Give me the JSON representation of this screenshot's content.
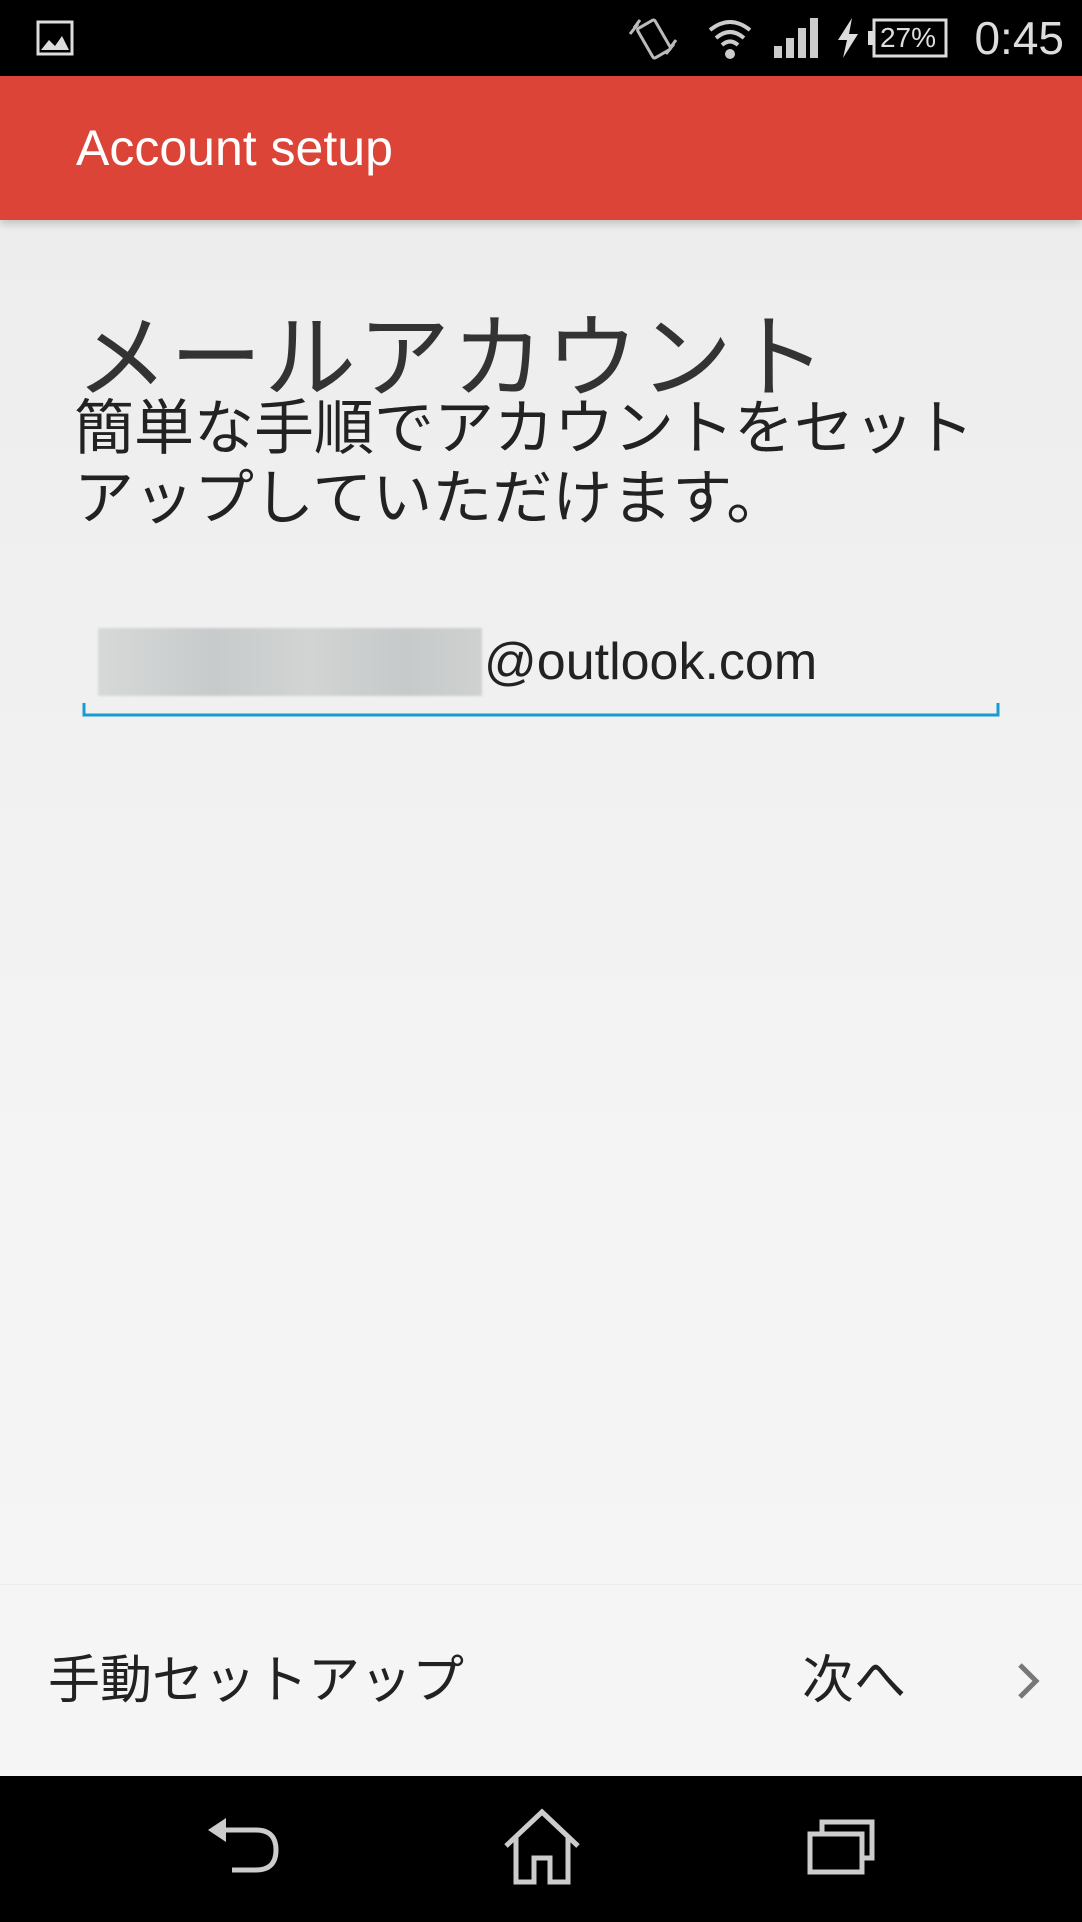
{
  "status_bar": {
    "battery": "27%",
    "time": "0:45",
    "icons": [
      "gallery-icon",
      "vibrate-icon",
      "wifi-icon",
      "signal-icon",
      "charging-icon",
      "battery-icon"
    ]
  },
  "app_bar": {
    "title": "Account setup",
    "color": "#dc4438"
  },
  "main": {
    "heading": "メールアカウント",
    "subtitle": "簡単な手順でアカウントをセットアップしていただけます。",
    "email": {
      "domain": "@outlook.com",
      "accent_color": "#1a9bd0"
    }
  },
  "actions": {
    "manual_setup": "手動セットアップ",
    "next": "次へ",
    "next_icon": "chevron-right-icon"
  },
  "nav_bar": {
    "icons": [
      "back-icon",
      "home-icon",
      "recent-apps-icon"
    ]
  }
}
